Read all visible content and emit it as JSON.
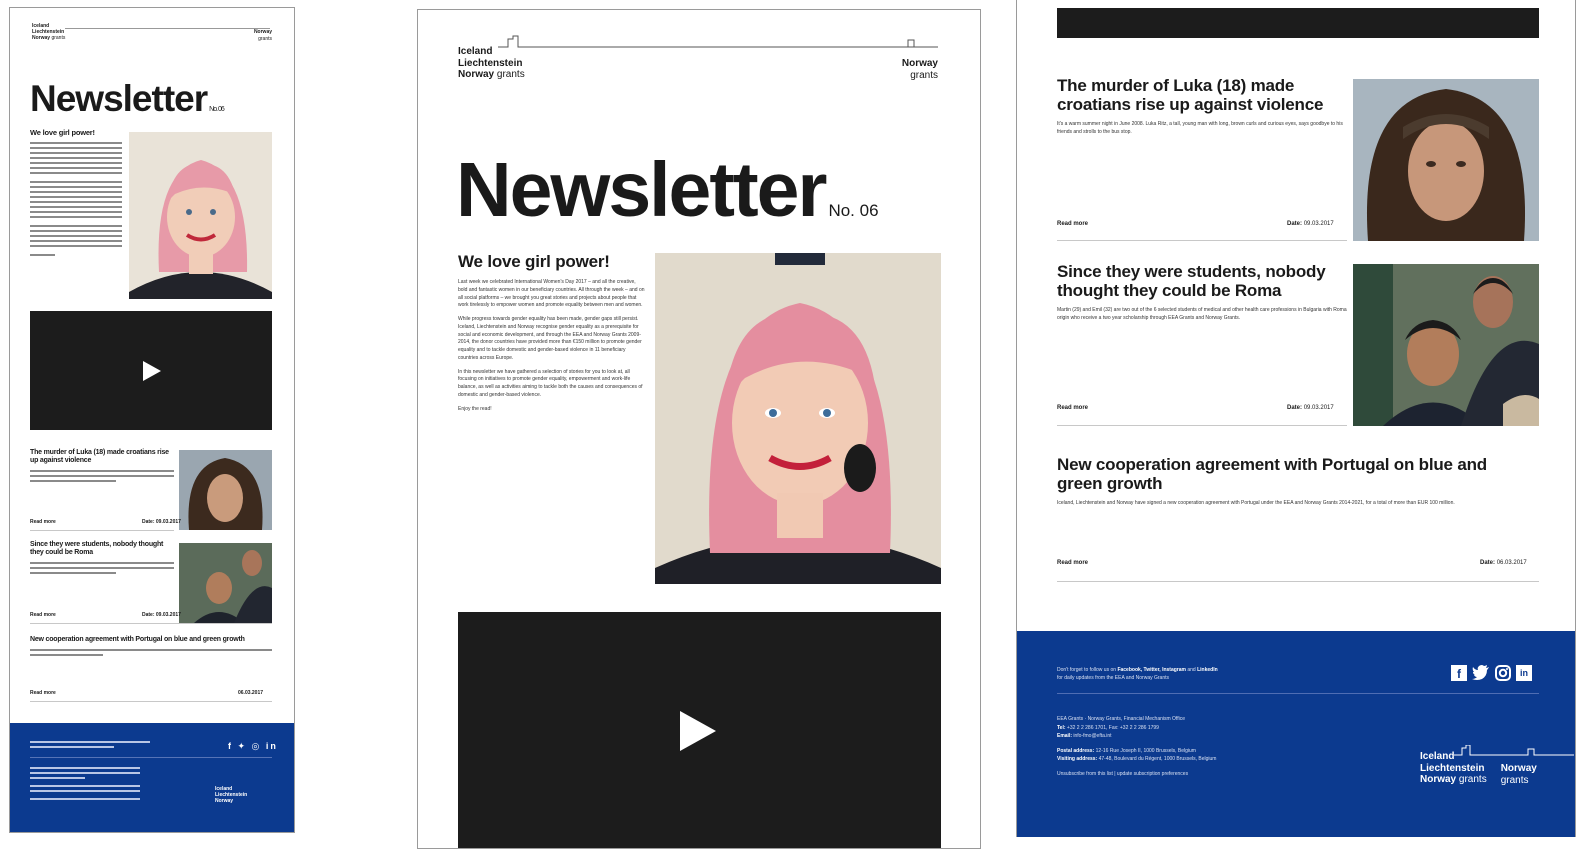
{
  "colors": {
    "brand_blue": "#0c3a8f",
    "video_dark": "#1c1c1c"
  },
  "logo": {
    "line1": "Iceland",
    "line2": "Liechtenstein",
    "line3": "Norway",
    "grants": "grants",
    "right_top": "Norway",
    "right_bottom": "grants"
  },
  "newsletter": {
    "title": "Newsletter",
    "issue": "No. 06"
  },
  "lead_article": {
    "title": "We love girl power!",
    "p1": "Last week we celebrated International Women's Day 2017 – and all the creative, bold and fantastic women in our beneficiary countries. All through the week – and on all social platforms – we brought you great stories and projects about people that work tirelessly to empower women and promote equality between men and women.",
    "p2": "While progress towards gender equality has been made, gender gaps still persist. Iceland, Liechtenstein and Norway recognise gender equality as a prerequisite for social and economic development, and through the EEA and Norway Grants 2009-2014, the donor countries have provided more than €150 million to promote gender equality and to tackle domestic and gender-based violence in 11 beneficiary countries across Europe.",
    "p3": "In this newsletter we have gathered a selection of stories for you to look at, all focusing on initiatives to promote gender equality, empowerment and work-life balance, as well as activities aiming to tackle both the causes and consequences of domestic and gender-based violence.",
    "read_label": "Enjoy the read!"
  },
  "articles": [
    {
      "title": "The murder of Luka (18) made croatians rise up against violence",
      "summary": "It's a warm summer night in June 2008. Luka Ritz, a tall, young man with long, brown curls and curious eyes, says goodbye to his friends and strolls to the bus stop.",
      "read_more": "Read more",
      "date_label": "Date:",
      "date": "09.03.2017"
    },
    {
      "title": "Since they were students, nobody thought they could be Roma",
      "summary": "Martin (29) and Emil (32) are two out of the 6 selected students of medical and other health care professions in Bulgaria with Roma origin who receive a two year scholarship through EEA Grants and Norway Grants.",
      "read_more": "Read more",
      "date_label": "Date:",
      "date": "09.03.2017"
    },
    {
      "title": "New cooperation agreement with Portugal on blue and green growth",
      "summary": "Iceland, Liechtenstein and Norway have signed a new cooperation agreement with Portugal under the EEA and Norway Grants 2014-2021, for a total of more than EUR 100 million.",
      "read_more": "Read more",
      "date_label": "Date:",
      "date": "06.03.2017"
    }
  ],
  "footer": {
    "follow_pre": "Don't forget to follow us on",
    "follow_links": "Facebook, Twitter, Instagram",
    "follow_and": "and",
    "follow_last": "LinkedIn",
    "follow_post": "for daily updates from the EEA and Norway Grants",
    "office": "EEA Grants · Norway Grants, Financial Mechanism Office",
    "tel_label": "Tel:",
    "tel": "+32 2 2 286 1701, Fax: +32 2 2 286 1799",
    "email_label": "Email:",
    "email": "info-fmo@efta.int",
    "postal_label": "Postal address:",
    "postal": "12-16 Rue Joseph II, 1000 Brussels, Belgium",
    "visiting_label": "Visiting address:",
    "visiting": "47-48, Boulevard du Régent, 1000 Brussels, Belgium",
    "unsubscribe": "Unsubscribe from this list | update subscription preferences",
    "social_icons": [
      "facebook-icon",
      "twitter-icon",
      "instagram-icon",
      "linkedin-icon"
    ]
  }
}
